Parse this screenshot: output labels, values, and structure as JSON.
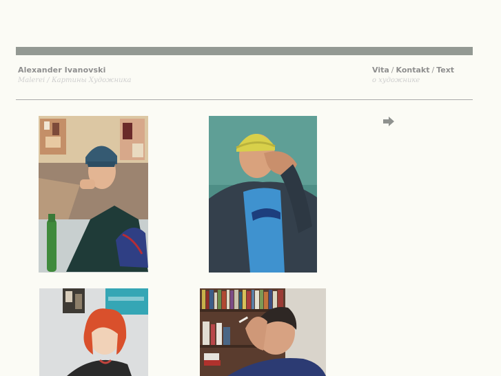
{
  "header": {
    "artist_name": "Alexander Ivanovski",
    "subtitle": "Malerei / Картины Художника"
  },
  "nav": {
    "links": [
      "Vita",
      "Kontakt",
      "Text"
    ],
    "separator": "/",
    "subtitle": "о художнике"
  },
  "gallery": {
    "next_arrow": "arrow-right-icon",
    "paintings": [
      "portrait-woman-blue-hat-cafe",
      "portrait-man-yellow-cap-blue-shirt",
      "portrait-woman-red-hair",
      "portrait-man-bookshelf"
    ]
  },
  "colors": {
    "background": "#fbfbf5",
    "bar": "#939993",
    "text": "#8e8e8e",
    "subtext": "#cfcfcf"
  }
}
